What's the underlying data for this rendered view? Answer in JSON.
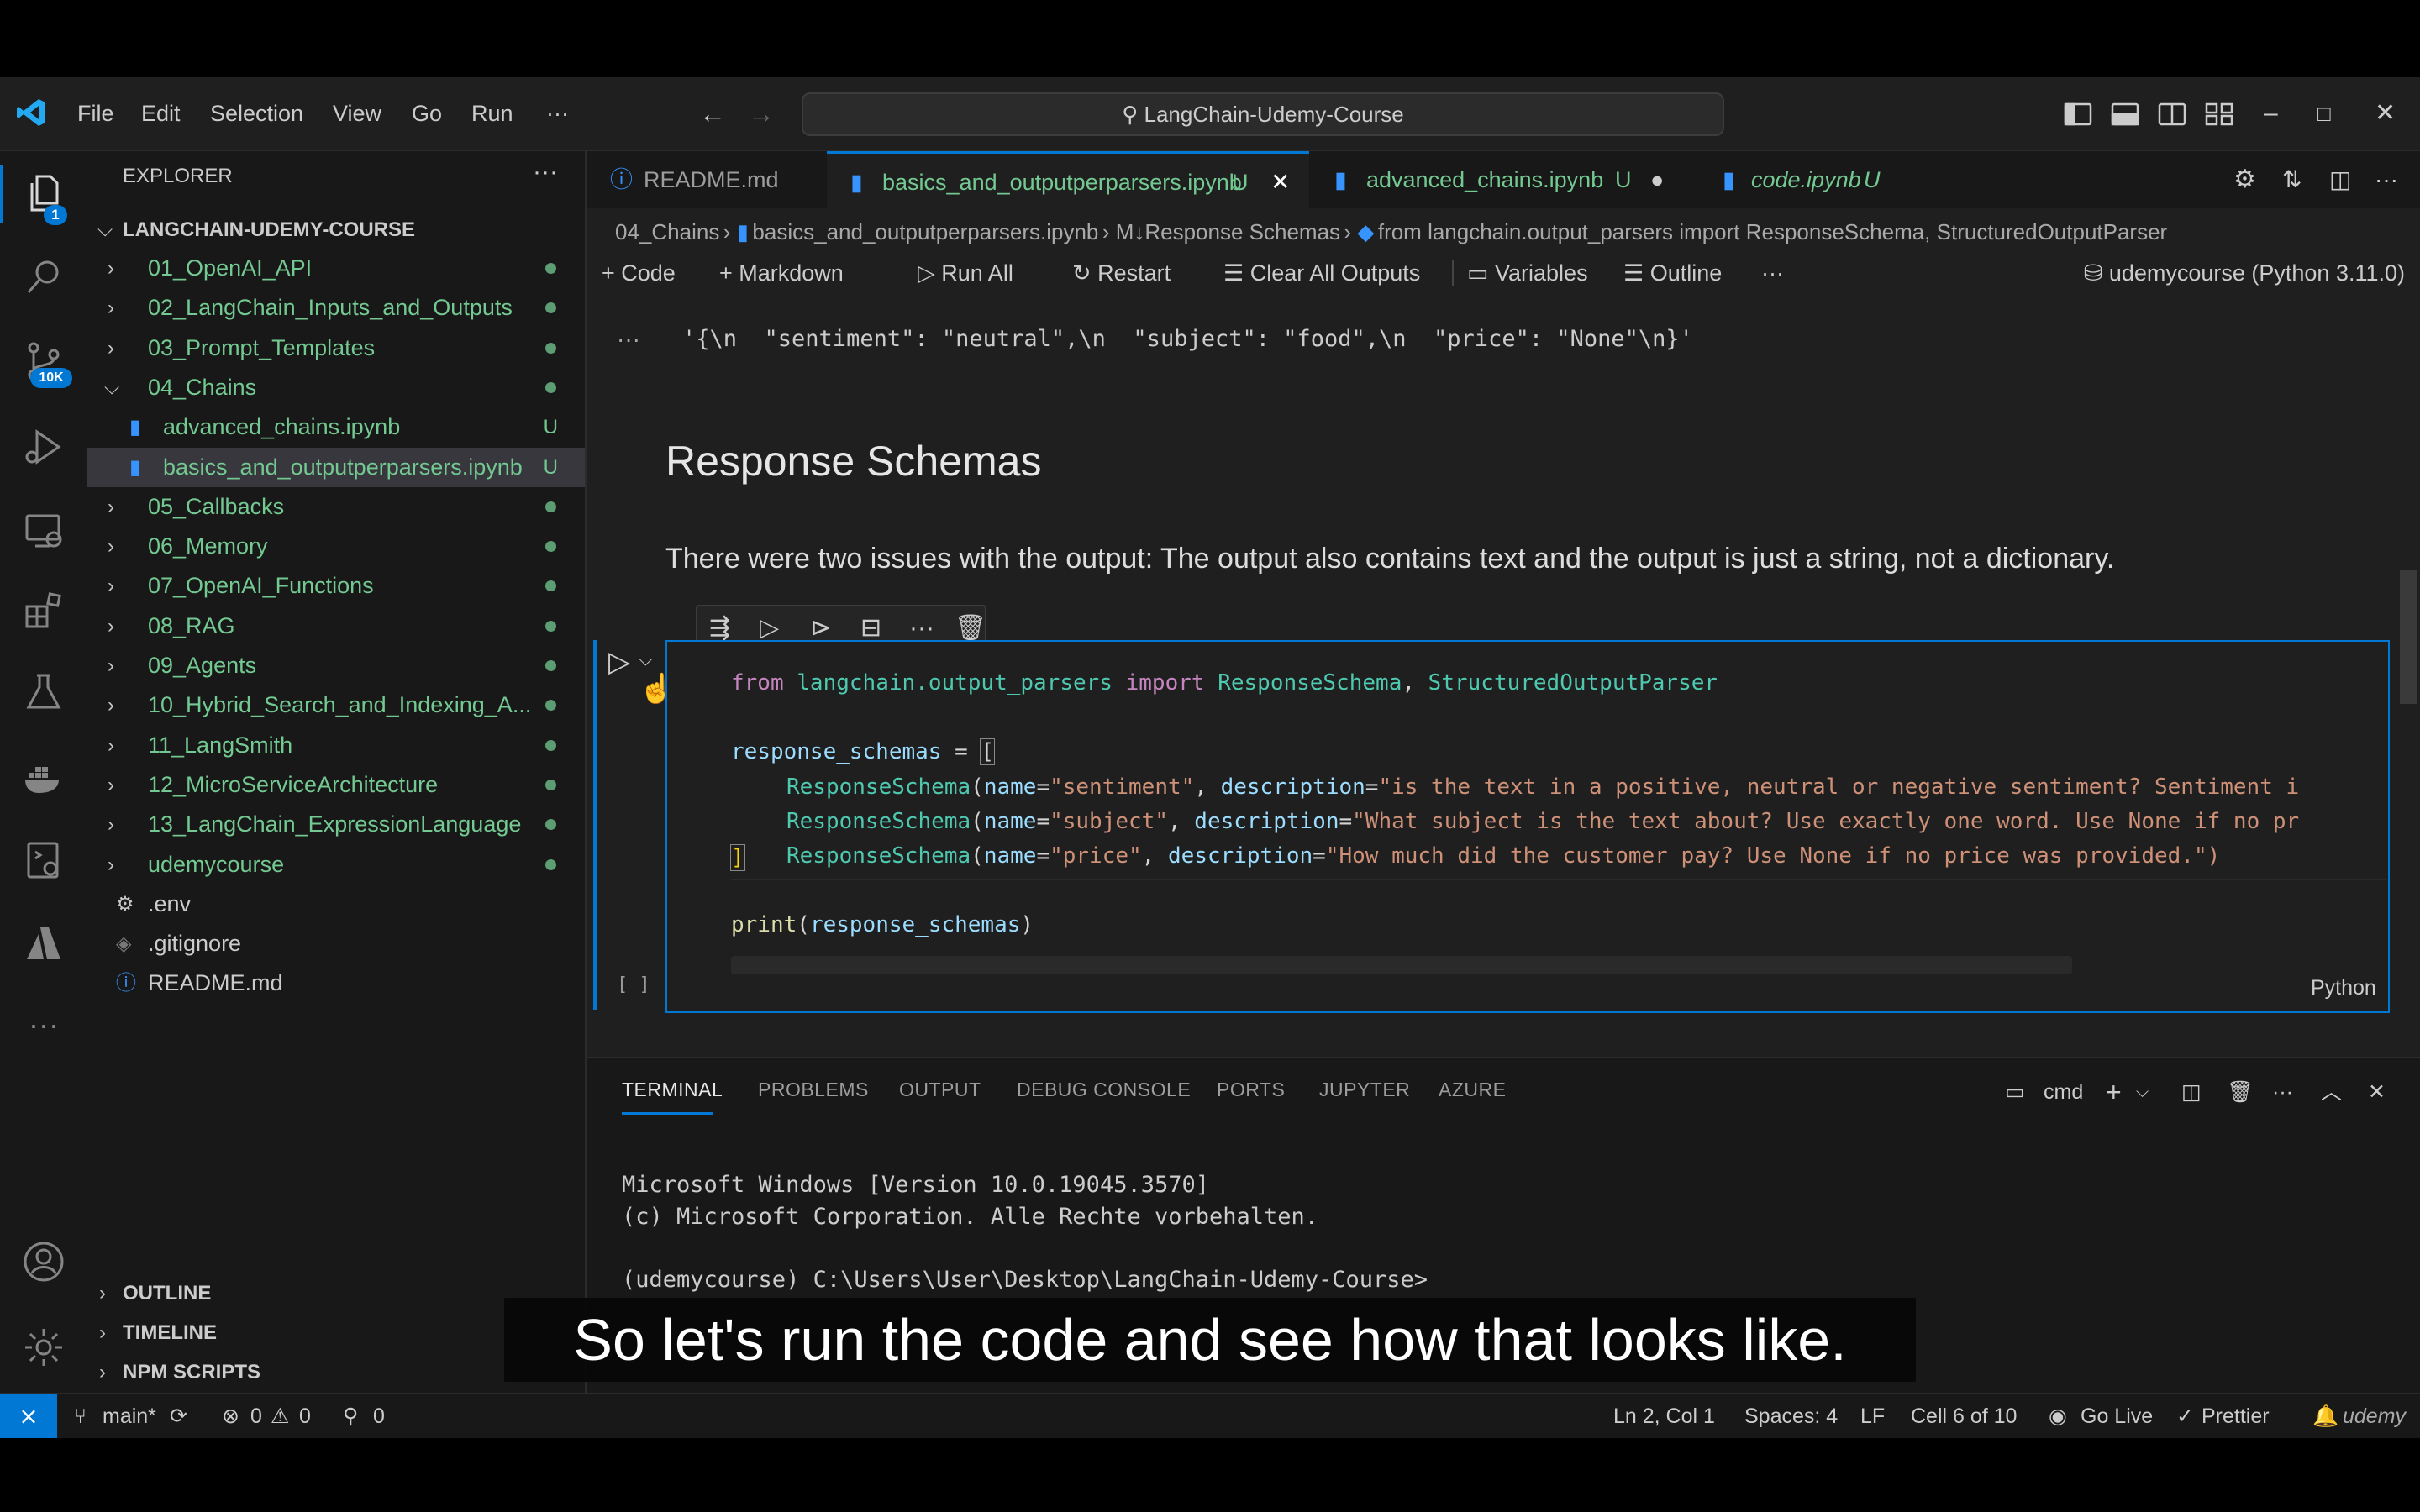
{
  "menu": [
    "File",
    "Edit",
    "Selection",
    "View",
    "Go",
    "Run",
    "···"
  ],
  "search_label": "LangChain-Udemy-Course",
  "activity": {
    "explorer_badge": "1",
    "source_control_badge": "10K"
  },
  "sidebar": {
    "title": "EXPLORER",
    "project": "LANGCHAIN-UDEMY-COURSE",
    "items": [
      {
        "label": "01_OpenAI_API",
        "type": "folder",
        "status": "dot"
      },
      {
        "label": "02_LangChain_Inputs_and_Outputs",
        "type": "folder",
        "status": "dot"
      },
      {
        "label": "03_Prompt_Templates",
        "type": "folder",
        "status": "dot"
      },
      {
        "label": "04_Chains",
        "type": "folder-open",
        "status": "dot"
      },
      {
        "label": "advanced_chains.ipynb",
        "type": "file",
        "status": "U"
      },
      {
        "label": "basics_and_outputperparsers.ipynb",
        "type": "file",
        "status": "U"
      },
      {
        "label": "05_Callbacks",
        "type": "folder",
        "status": "dot"
      },
      {
        "label": "06_Memory",
        "type": "folder",
        "status": "dot"
      },
      {
        "label": "07_OpenAI_Functions",
        "type": "folder",
        "status": "dot"
      },
      {
        "label": "08_RAG",
        "type": "folder",
        "status": "dot"
      },
      {
        "label": "09_Agents",
        "type": "folder",
        "status": "dot"
      },
      {
        "label": "10_Hybrid_Search_and_Indexing_A...",
        "type": "folder",
        "status": "dot"
      },
      {
        "label": "11_LangSmith",
        "type": "folder",
        "status": "dot"
      },
      {
        "label": "12_MicroServiceArchitecture",
        "type": "folder",
        "status": "dot"
      },
      {
        "label": "13_LangChain_ExpressionLanguage",
        "type": "folder",
        "status": "dot"
      },
      {
        "label": "udemycourse",
        "type": "folder",
        "status": "dot"
      },
      {
        "label": ".env",
        "type": "gear",
        "status": ""
      },
      {
        "label": ".gitignore",
        "type": "diamond",
        "status": ""
      },
      {
        "label": "README.md",
        "type": "info",
        "status": ""
      }
    ],
    "bottom_sections": [
      "OUTLINE",
      "TIMELINE",
      "NPM SCRIPTS"
    ]
  },
  "tabs": [
    {
      "label": "README.md",
      "mark": ""
    },
    {
      "label": "basics_and_outputperparsers.ipynb",
      "mark": "U"
    },
    {
      "label": "advanced_chains.ipynb",
      "mark": "U"
    },
    {
      "label": "code.ipynb",
      "mark": "U"
    }
  ],
  "breadcrumb": [
    "04_Chains",
    "basics_and_outputperparsers.ipynb",
    "M↓Response Schemas",
    "from langchain.output_parsers import ResponseSchema, StructuredOutputParser"
  ],
  "toolbar": {
    "code": "Code",
    "markdown": "Markdown",
    "run_all": "Run All",
    "restart": "Restart",
    "clear": "Clear All Outputs",
    "variables": "Variables",
    "outline": "Outline",
    "more": "···",
    "kernel": "udemycourse (Python 3.11.0)"
  },
  "output_line": "'{\\n  \"sentiment\": \"neutral\",\\n  \"subject\": \"food\",\\n  \"price\": \"None\"\\n}'",
  "markdown": {
    "heading": "Response Schemas",
    "paragraph": "There were two issues with the output: The output also contains text and the output is just a string, not a dictionary."
  },
  "cell": {
    "exec_count": "[ ]",
    "language": "Python",
    "line1": {
      "kw1": "from",
      "mod": "langchain.output_parsers",
      "kw2": "import",
      "c1": "ResponseSchema",
      "sep": ", ",
      "c2": "StructuredOutputParser"
    },
    "line2": {
      "var": "response_schemas",
      "op": " = ",
      "br": "["
    },
    "schema_rows": [
      {
        "cls": "ResponseSchema",
        "p1": "(",
        "n": "name",
        "e1": "=",
        "v1": "\"sentiment\"",
        "c": ", ",
        "d": "description",
        "e2": "=",
        "v2": "\"is the text in a positive, neutral or negative sentiment? Sentiment i"
      },
      {
        "cls": "ResponseSchema",
        "p1": "(",
        "n": "name",
        "e1": "=",
        "v1": "\"subject\"",
        "c": ", ",
        "d": "description",
        "e2": "=",
        "v2": "\"What subject is the text about? Use exactly one word. Use None if no pr"
      },
      {
        "cls": "ResponseSchema",
        "p1": "(",
        "n": "name",
        "e1": "=",
        "v1": "\"price\"",
        "c": ", ",
        "d": "description",
        "e2": "=",
        "v2": "\"How much did the customer pay? Use None if no price was provided.\")"
      }
    ],
    "close_bracket": "]",
    "line_print": {
      "fn": "print",
      "p1": "(",
      "arg": "response_schemas",
      "p2": ")"
    }
  },
  "panel": {
    "tabs": [
      "TERMINAL",
      "PROBLEMS",
      "OUTPUT",
      "DEBUG CONSOLE",
      "PORTS",
      "JUPYTER",
      "AZURE"
    ],
    "shell": "cmd",
    "lines": [
      "Microsoft Windows [Version 10.0.19045.3570]",
      "(c) Microsoft Corporation. Alle Rechte vorbehalten.",
      "",
      "(udemycourse) C:\\Users\\User\\Desktop\\LangChain-Udemy-Course>"
    ]
  },
  "status": {
    "branch": "main*",
    "errors": "0",
    "warnings": "0",
    "ports": "0",
    "position": "Ln 2, Col 1",
    "spaces": "Spaces: 4",
    "eol": "LF",
    "cell": "Cell 6 of 10",
    "golive": "Go Live",
    "prettier": "Prettier",
    "brand": "udemy"
  },
  "caption": "So let's run the code and see how that looks like."
}
